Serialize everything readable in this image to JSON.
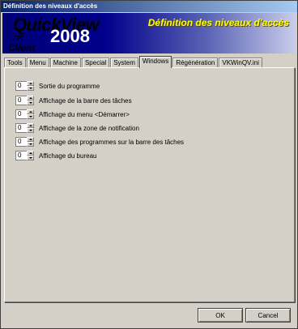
{
  "window": {
    "title": "Définition des niveaux d'accès"
  },
  "banner": {
    "brand": "QuickView",
    "fpl": "FPL",
    "year": "2008",
    "client": "Client",
    "title": "Définition des niveaux d'accès"
  },
  "tabs": [
    {
      "label": "Tools"
    },
    {
      "label": "Menu"
    },
    {
      "label": "Machine"
    },
    {
      "label": "Special"
    },
    {
      "label": "System"
    },
    {
      "label": "Windows"
    },
    {
      "label": "Régénération"
    },
    {
      "label": "VKWinQV.ini"
    }
  ],
  "active_tab": "Windows",
  "settings": [
    {
      "value": "0",
      "label": "Sortie du programme"
    },
    {
      "value": "0",
      "label": "Affichage de la barre des tâches"
    },
    {
      "value": "0",
      "label": "Affichage du menu <Démarrer>"
    },
    {
      "value": "0",
      "label": "Affichage de la zone de notification"
    },
    {
      "value": "0",
      "label": "Affichage des programmes sur la barre des tâches"
    },
    {
      "value": "0",
      "label": "Affichage du bureau"
    }
  ],
  "buttons": {
    "ok": "OK",
    "cancel": "Cancel"
  }
}
